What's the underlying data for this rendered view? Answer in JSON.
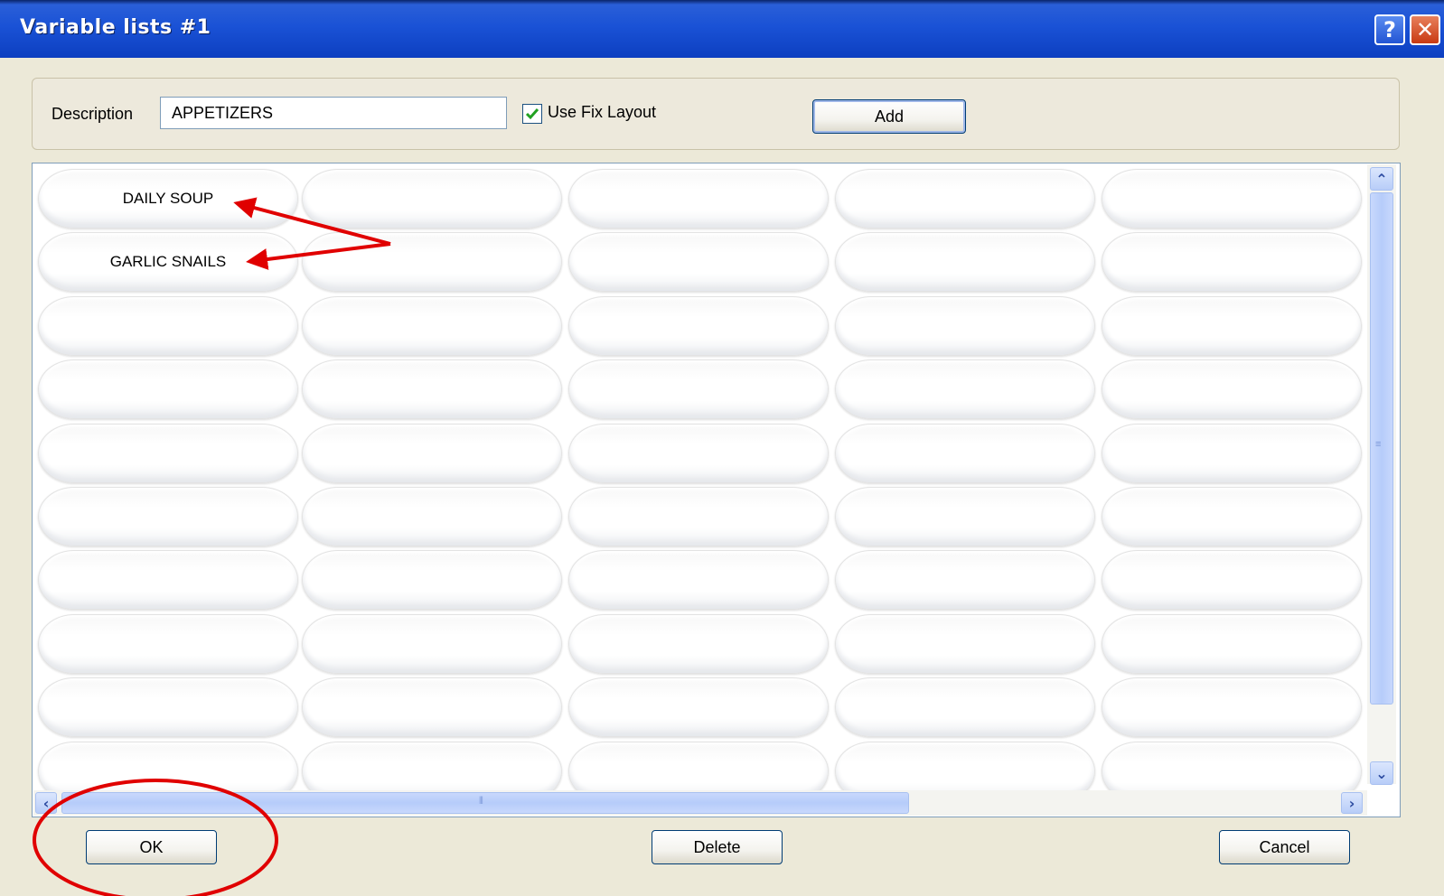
{
  "window": {
    "title": "Variable lists #1",
    "help_glyph": "?",
    "close_glyph": "✕"
  },
  "form": {
    "description_label": "Description",
    "description_value": "APPETIZERS",
    "use_fix_layout_label": "Use Fix Layout",
    "use_fix_layout_checked": true,
    "add_label": "Add"
  },
  "grid": {
    "columns": 5,
    "rows": 10,
    "items": [
      "DAILY SOUP",
      "",
      "",
      "",
      "",
      "GARLIC SNAILS",
      "",
      "",
      "",
      ""
    ]
  },
  "footer": {
    "ok_label": "OK",
    "delete_label": "Delete",
    "cancel_label": "Cancel"
  },
  "colors": {
    "title_bar": "#1a52d6",
    "annotation": "#e00000"
  }
}
